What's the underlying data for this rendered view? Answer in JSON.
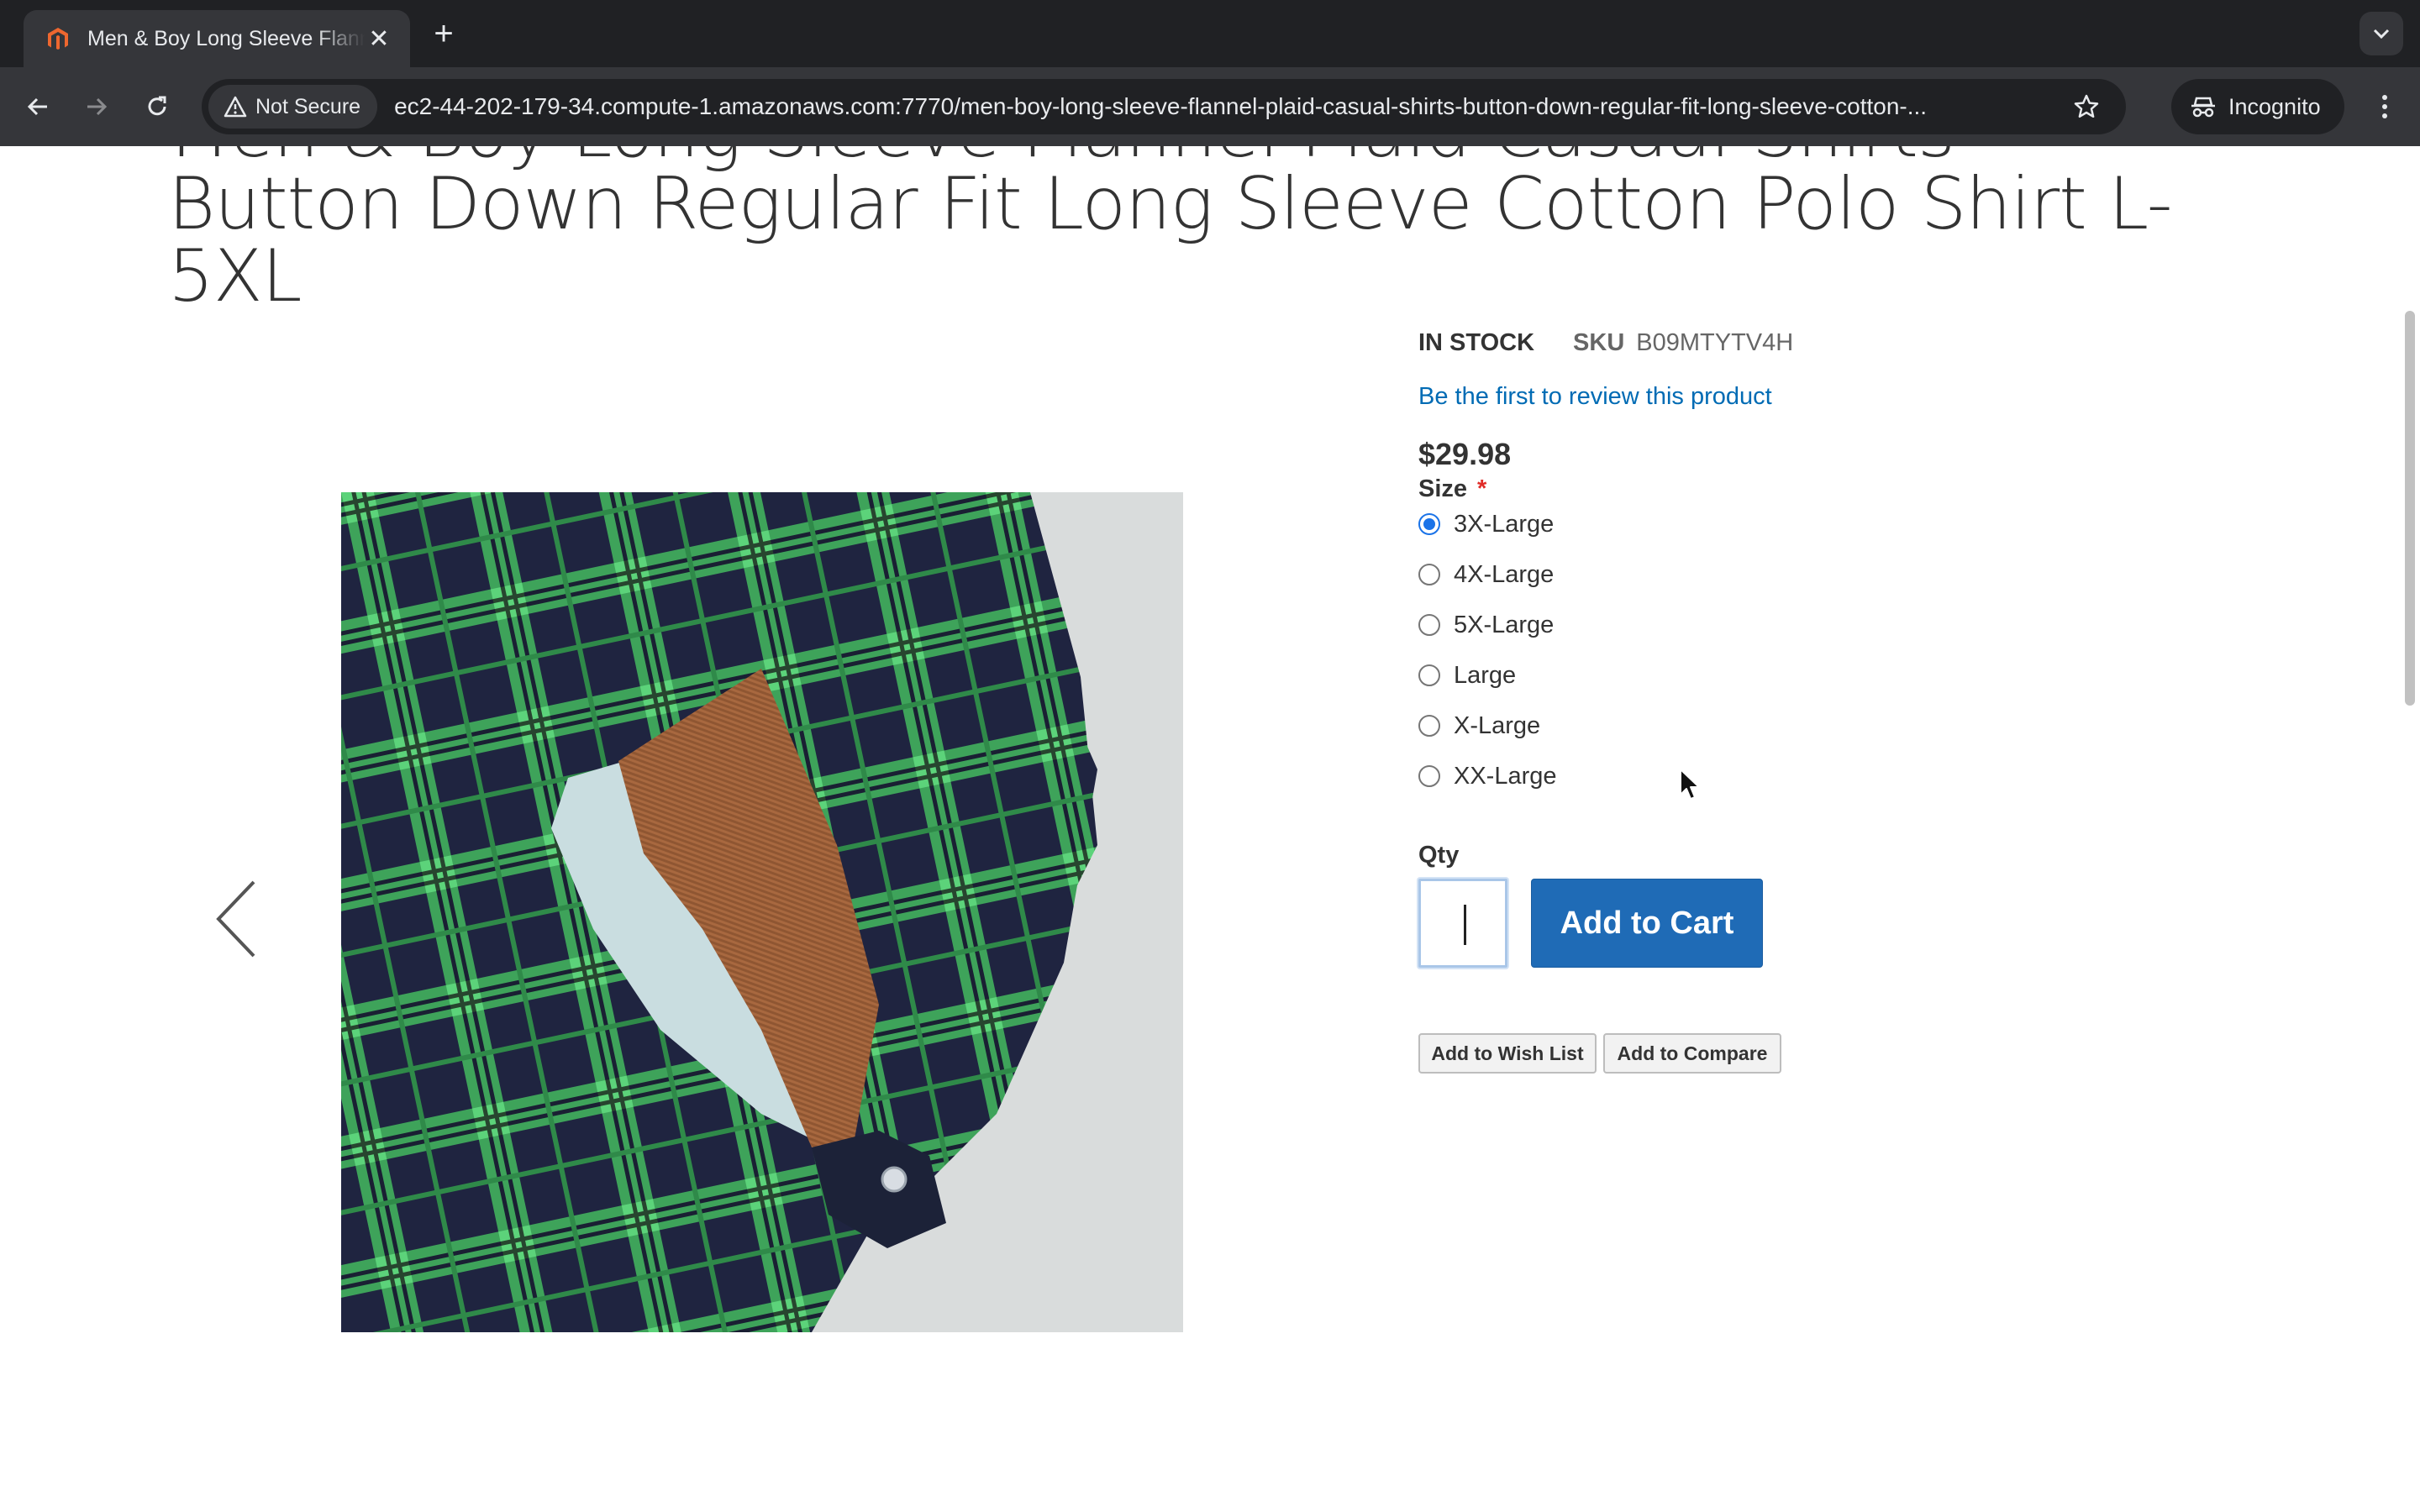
{
  "browser": {
    "tab": {
      "title": "Men & Boy Long Sleeve Flannel Plaid Casual Shirts Button Down Regular Fit Long Sleeve Cotton Polo Shirt L-5XL",
      "favicon": "magento-icon"
    },
    "security_label": "Not Secure",
    "url": "ec2-44-202-179-34.compute-1.amazonaws.com:7770/men-boy-long-sleeve-flannel-plaid-casual-shirts-button-down-regular-fit-long-sleeve-cotton-...",
    "incognito_label": "Incognito"
  },
  "product": {
    "title": "Men & Boy Long Sleeve Flannel Plaid Casual Shirts Button Down Regular Fit Long Sleeve Cotton Polo Shirt L-5XL",
    "stock": "IN STOCK",
    "sku_label": "SKU",
    "sku": "B09MTYTV4H",
    "review_link": "Be the first to review this product",
    "price": "$29.98",
    "size_label": "Size",
    "required_marker": "*",
    "sizes": [
      {
        "label": "3X-Large",
        "selected": true
      },
      {
        "label": "4X-Large",
        "selected": false
      },
      {
        "label": "5X-Large",
        "selected": false
      },
      {
        "label": "Large",
        "selected": false
      },
      {
        "label": "X-Large",
        "selected": false
      },
      {
        "label": "XX-Large",
        "selected": false
      }
    ],
    "qty_label": "Qty",
    "qty_value": "",
    "add_to_cart_label": "Add to Cart",
    "add_to_wishlist_label": "Add to Wish List",
    "add_to_compare_label": "Add to Compare"
  },
  "colors": {
    "link": "#006bb4",
    "primary_button": "#1f6bb6",
    "required": "#e02b27",
    "plaid_green": "#3ea35a",
    "plaid_navy": "#1f2440"
  }
}
